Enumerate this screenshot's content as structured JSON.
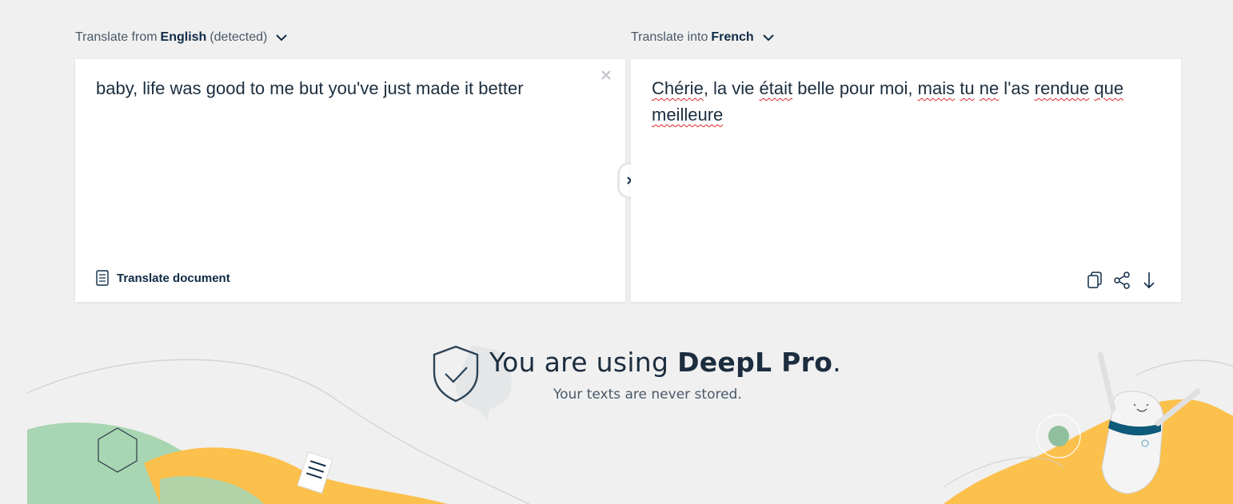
{
  "source": {
    "prefix": "Translate from",
    "language": "English",
    "detected": "(detected)",
    "text": "baby, life was good to me but you've just made it better",
    "doc_button": "Translate document"
  },
  "target": {
    "prefix": "Translate into",
    "language": "French",
    "words": [
      {
        "t": "Chérie",
        "sq": true
      },
      {
        "t": ", la vie ",
        "sq": false
      },
      {
        "t": "était",
        "sq": true
      },
      {
        "t": " belle pour moi, ",
        "sq": false
      },
      {
        "t": "mais",
        "sq": true
      },
      {
        "t": " ",
        "sq": false
      },
      {
        "t": "tu",
        "sq": true
      },
      {
        "t": " ",
        "sq": false
      },
      {
        "t": "ne",
        "sq": true
      },
      {
        "t": " l'as ",
        "sq": false
      },
      {
        "t": "rendue",
        "sq": true
      },
      {
        "t": " ",
        "sq": false
      },
      {
        "t": "que",
        "sq": true
      },
      {
        "t": " ",
        "sq": false
      },
      {
        "t": "meilleure",
        "sq": true
      }
    ]
  },
  "pro": {
    "prefix": "You are using ",
    "brand": "DeepL Pro",
    "suffix": ".",
    "subtitle": "Your texts are never stored."
  },
  "colors": {
    "accent": "#0f2b46",
    "squiggle": "#d9262c",
    "green": "#a8d5b2",
    "yellow": "#fcc04c"
  }
}
